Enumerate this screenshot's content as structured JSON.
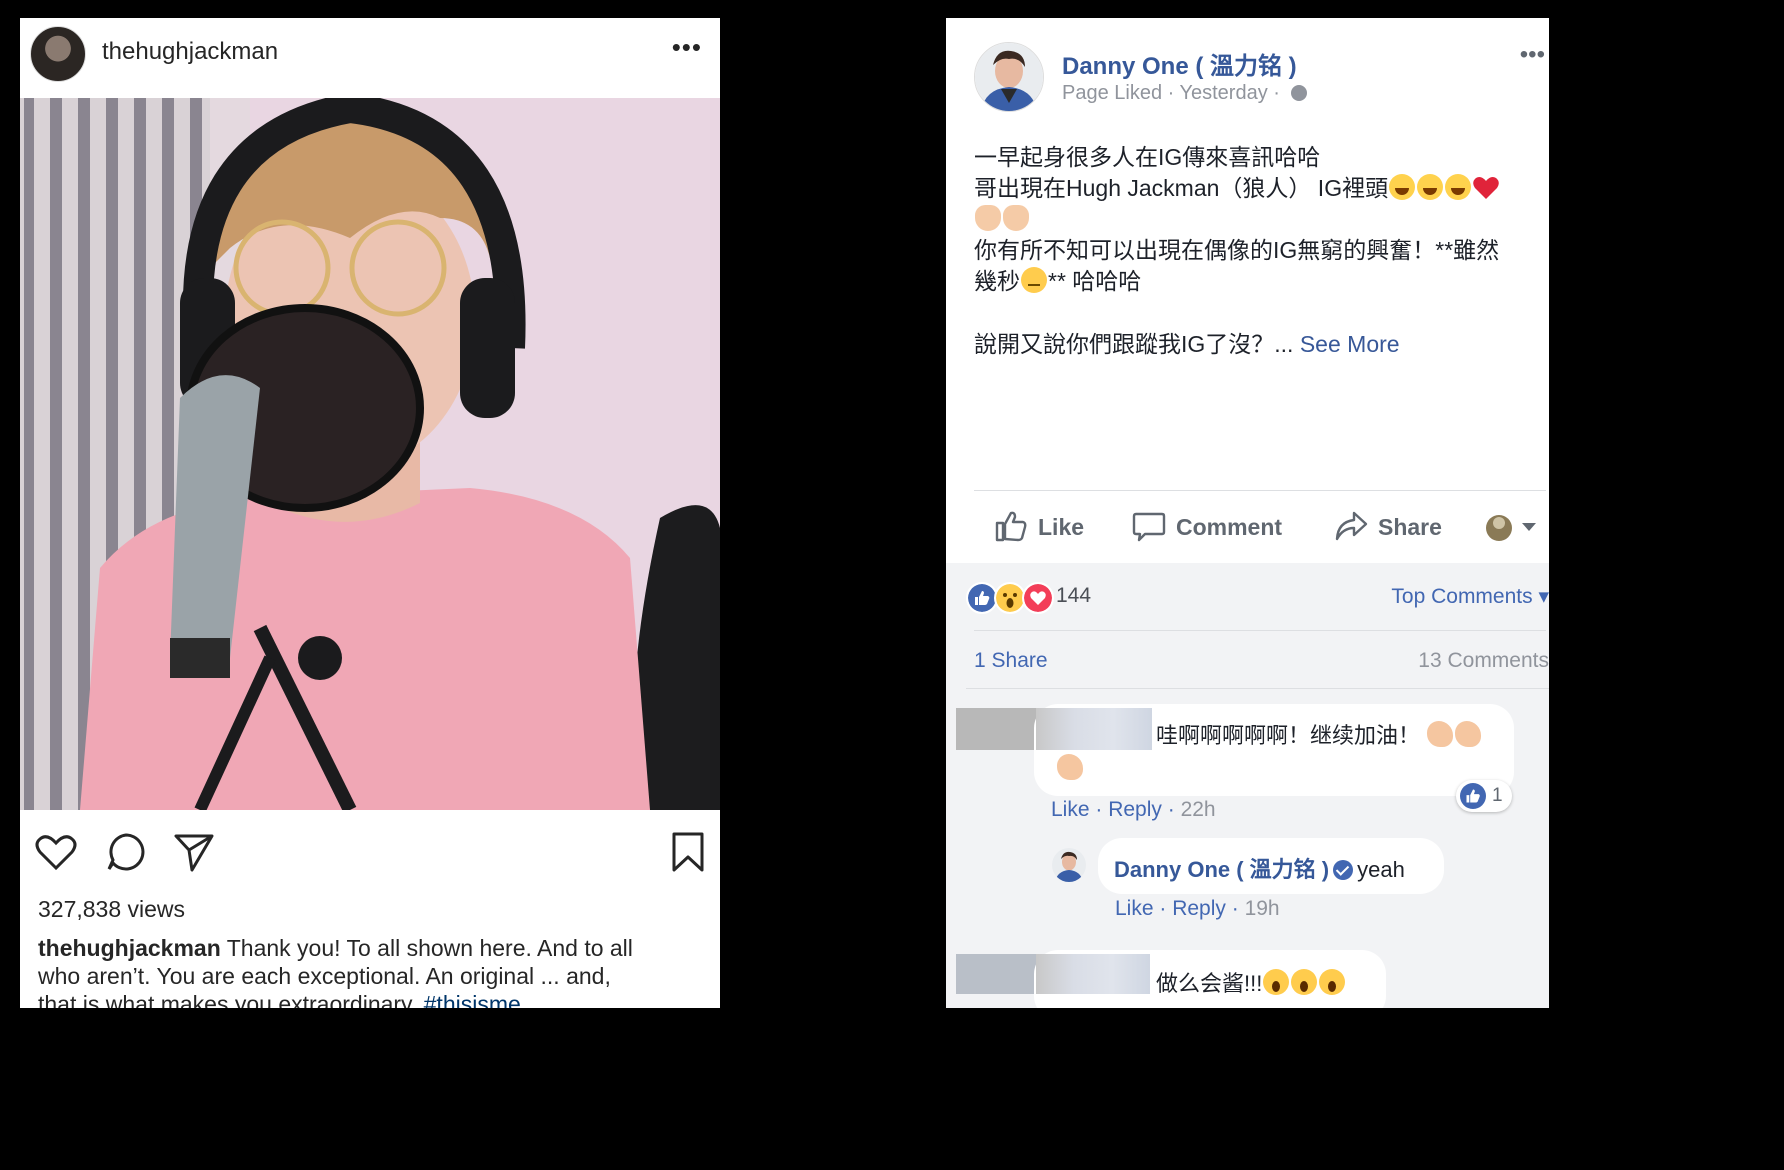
{
  "instagram": {
    "username": "thehughjackman",
    "views": "327,838 views",
    "caption_user": "thehughjackman",
    "caption_lines": [
      " Thank you! To all shown here. And to all",
      "who aren’t. You are each exceptional. An original ... and,",
      "that is what makes you extraordinary. "
    ],
    "caption_tag": "#thisisme",
    "icons": [
      "heart-icon",
      "comment-icon",
      "share-icon",
      "bookmark-icon",
      "more-icon"
    ]
  },
  "facebook": {
    "page_name": "Danny One ( 溫力铭 )",
    "meta": "Page Liked · Yesterday · ",
    "body": {
      "line1": "一早起身很多人在IG傳來喜訊哈哈",
      "line2": "哥出現在Hugh Jackman（狼人） IG裡頭",
      "line4": "你有所不知可以出現在偶像的IG無窮的興奮！**雖然",
      "line5a": "幾秒",
      "line5b": "** 哈哈哈",
      "line7": "說開又說你們跟蹤我IG了沒？... ",
      "see_more": "See More"
    },
    "actions": {
      "like": "Like",
      "comment": "Comment",
      "share": "Share"
    },
    "reaction_count": "144",
    "top_comments": "Top Comments ▾",
    "shares": "1 Share",
    "comments_count": "13 Comments",
    "comments": [
      {
        "text": "哇啊啊啊啊啊！继续加油！",
        "like": "Like",
        "reply": "Reply",
        "time": "22h",
        "like_badge": "1"
      },
      {
        "author": "Danny One ( 溫力铭 )",
        "text": "yeah",
        "like": "Like",
        "reply": "Reply",
        "time": "19h"
      },
      {
        "text": "做么会酱!!!"
      }
    ],
    "colors": {
      "link": "#365899",
      "like_blue": "#4267b2",
      "love_red": "#f33e58",
      "wow_yellow": "#ffcc4d"
    }
  }
}
